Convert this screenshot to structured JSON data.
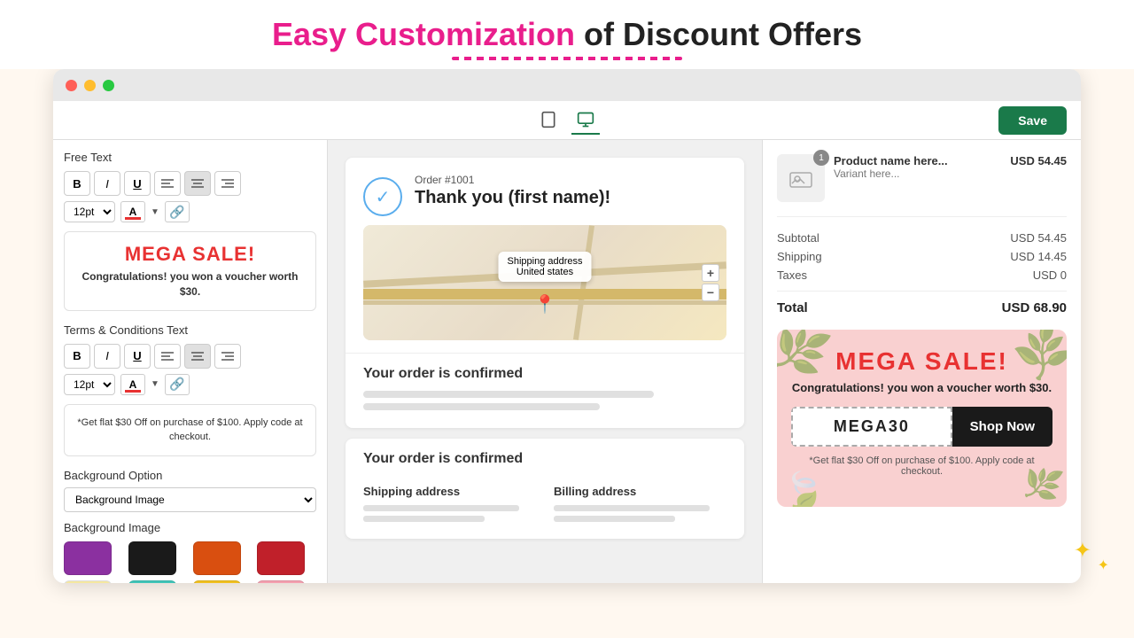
{
  "page": {
    "title_normal": "of Discount Offers",
    "title_highlight": "Easy Customization"
  },
  "window": {
    "save_button": "Save"
  },
  "left_panel": {
    "free_text_label": "Free Text",
    "font_size": "12pt",
    "mega_sale_text": "MEGA SALE!",
    "congrats_text": "Congratulations! you won a voucher worth $30.",
    "terms_label": "Terms & Conditions Text",
    "terms_font_size": "12pt",
    "terms_text": "*Get flat $30 Off on purchase of $100. Apply code at checkout.",
    "bg_option_label": "Background Option",
    "bg_option_value": "Background Image",
    "bg_image_label": "Background Image"
  },
  "email_preview": {
    "order_number": "Order #1001",
    "thank_you": "Thank you (first name)!",
    "map_popup_line1": "Shipping address",
    "map_popup_line2": "United states",
    "confirmed_title1": "Your order is confirmed",
    "confirmed_title2": "Your order is confirmed",
    "shipping_address_label": "Shipping address",
    "billing_address_label": "Billing address"
  },
  "right_panel": {
    "product_name": "Product name here...",
    "product_variant": "Variant here...",
    "product_price": "USD 54.45",
    "product_badge": "1",
    "subtotal_label": "Subtotal",
    "subtotal_value": "USD 54.45",
    "shipping_label": "Shipping",
    "shipping_value": "USD 14.45",
    "taxes_label": "Taxes",
    "taxes_value": "USD 0",
    "total_label": "Total",
    "total_value": "USD 68.90",
    "promo_mega_sale": "MEGA SALE!",
    "promo_congrats": "Congratulations! you won a voucher worth $30.",
    "promo_code": "MEGA30",
    "shop_now": "Shop Now",
    "promo_terms": "*Get flat $30 Off on purchase of $100. Apply code at checkout."
  },
  "swatches": [
    {
      "color": "#8b30a0",
      "name": "purple"
    },
    {
      "color": "#1a1a1a",
      "name": "black"
    },
    {
      "color": "#d94f10",
      "name": "orange"
    },
    {
      "color": "#c0202a",
      "name": "dark-red"
    },
    {
      "color": "#f5e8a0",
      "name": "yellow-light"
    },
    {
      "color": "#40c4b8",
      "name": "teal"
    },
    {
      "color": "#f0c020",
      "name": "yellow"
    },
    {
      "color": "#f4a0b0",
      "name": "pink"
    }
  ],
  "toolbar": {
    "bold": "B",
    "italic": "I",
    "underline": "U",
    "align_left": "≡",
    "align_center": "≡",
    "align_right": "≡"
  }
}
